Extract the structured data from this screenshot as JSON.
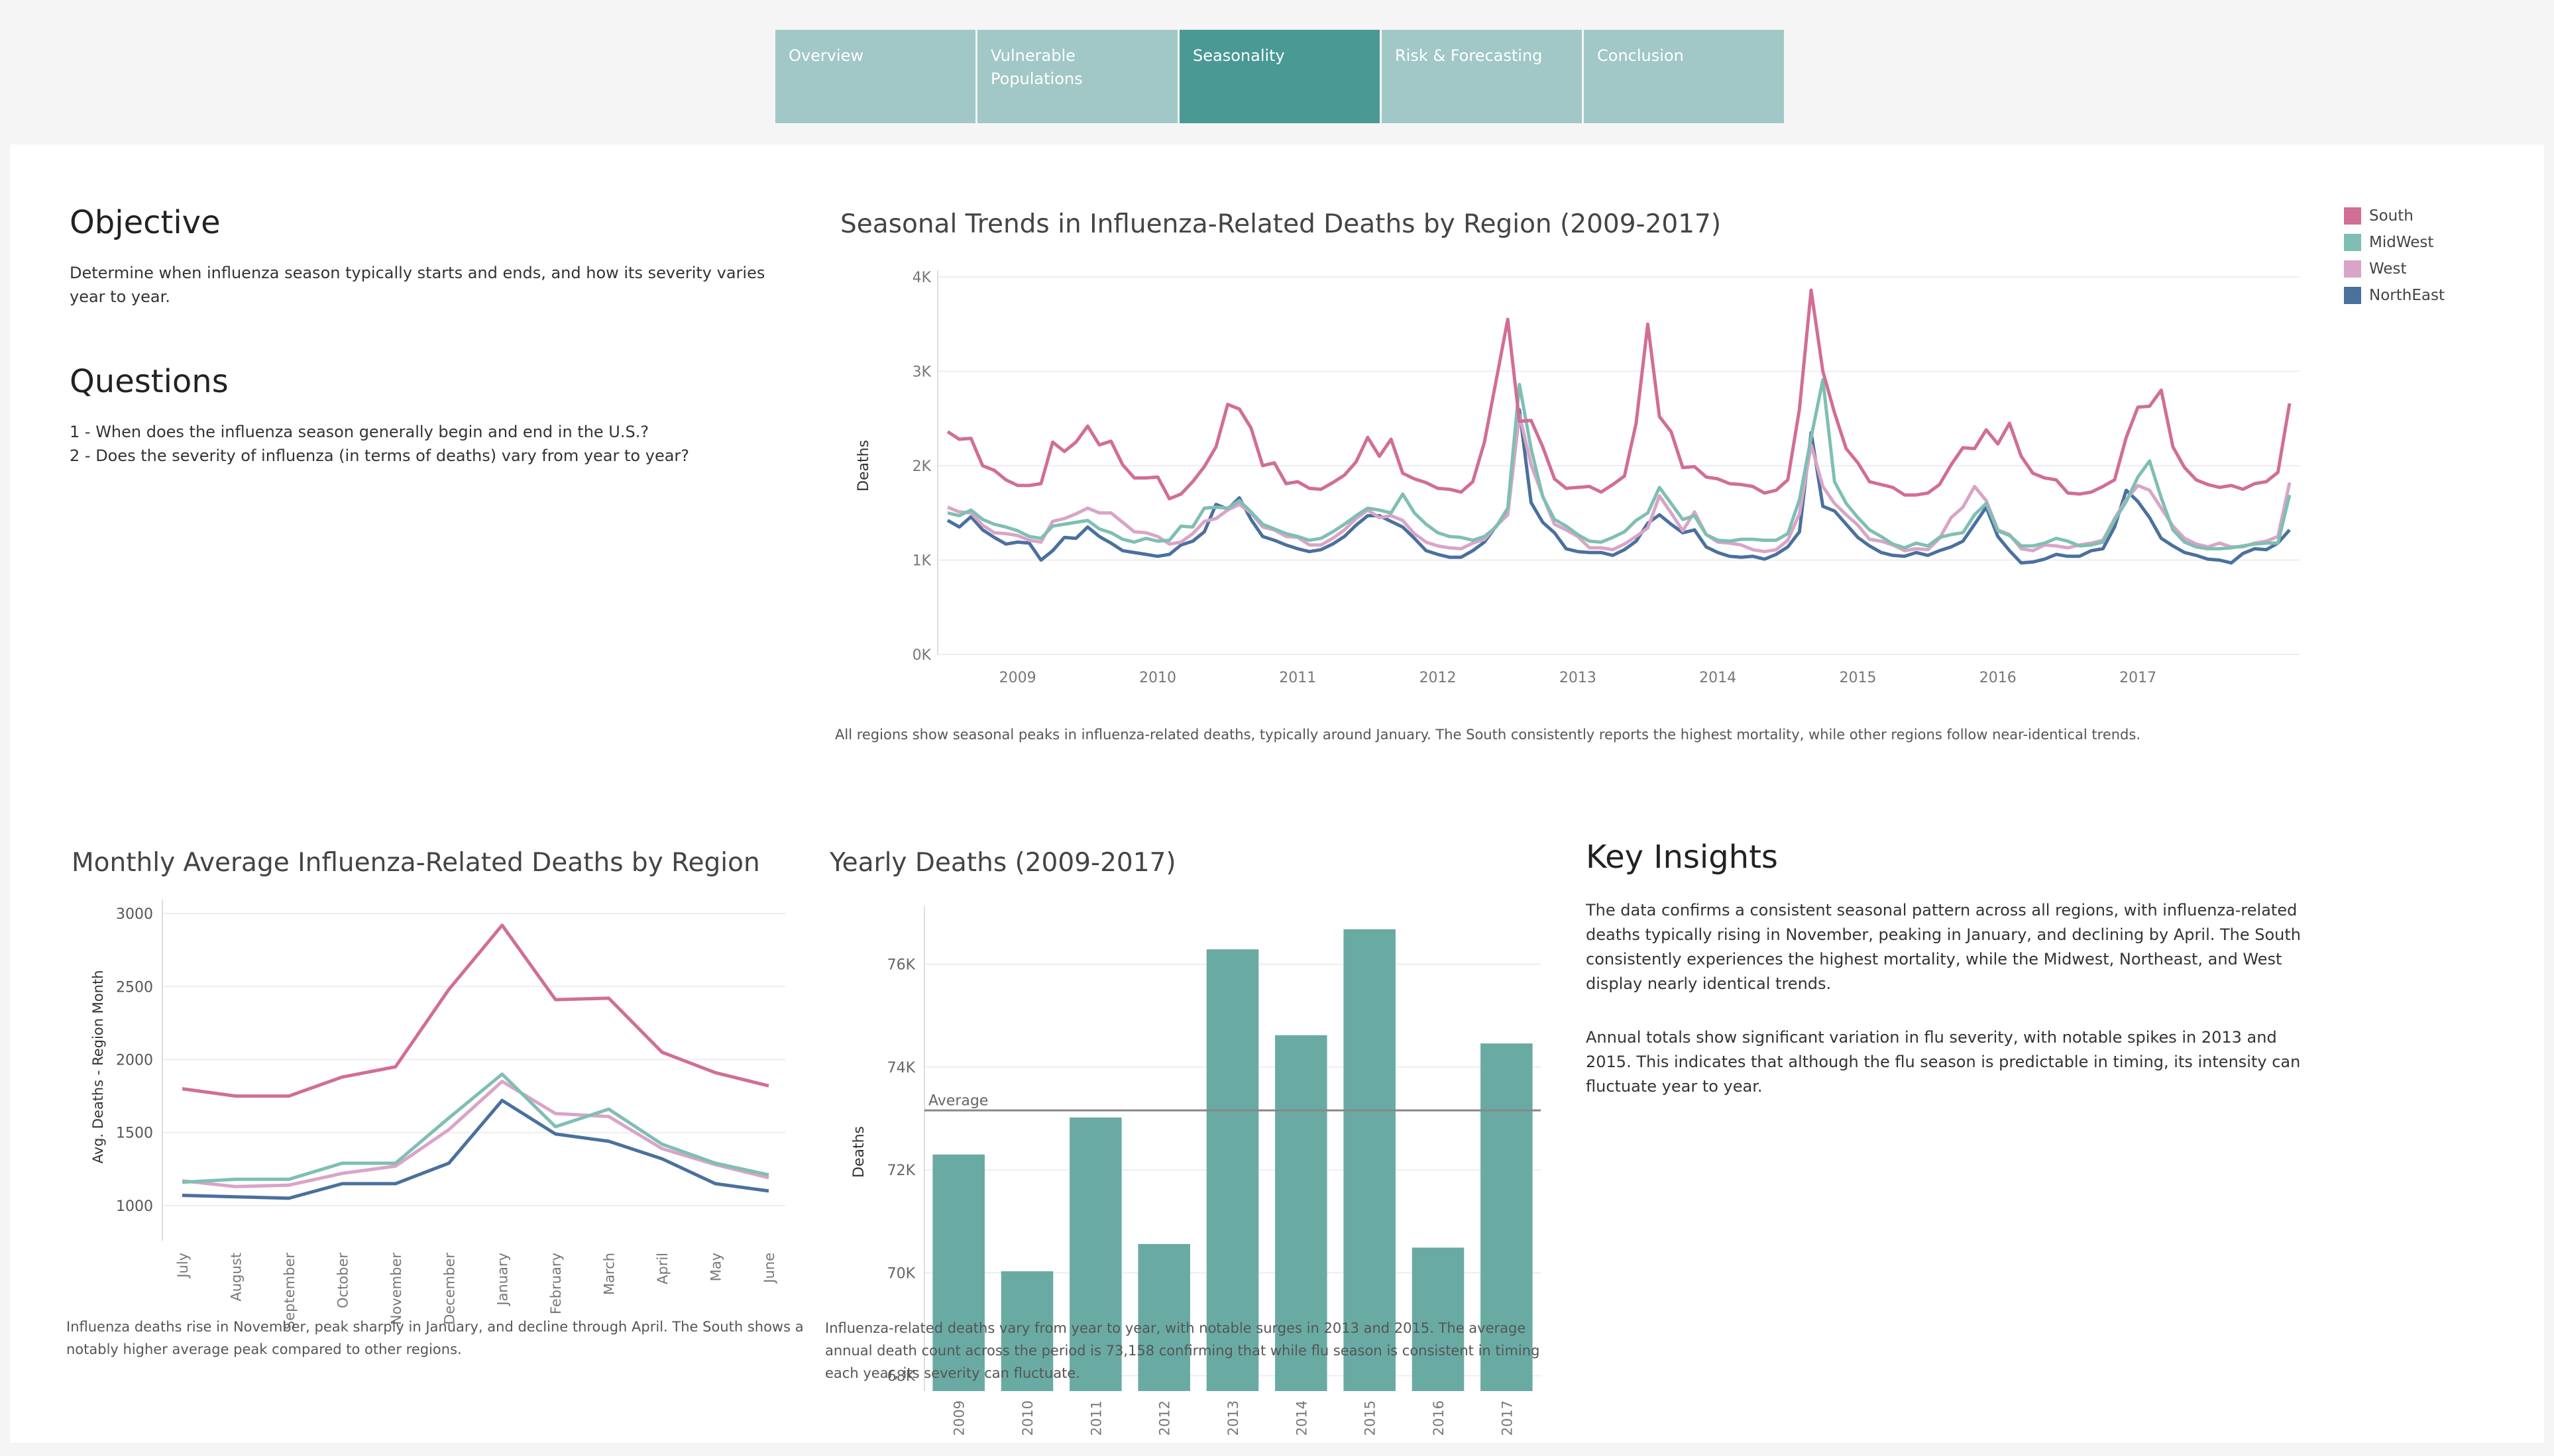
{
  "tabs": [
    {
      "label": "Overview"
    },
    {
      "label": "Vulnerable Populations"
    },
    {
      "label": "Seasonality",
      "active": true
    },
    {
      "label": "Risk & Forecasting"
    },
    {
      "label": "Conclusion"
    }
  ],
  "objective": {
    "title": "Objective",
    "text": "Determine when influenza season typically starts and ends, and how its severity varies year to year."
  },
  "questions": {
    "title": "Questions",
    "q1": "1 - When does the influenza season generally begin and end in the U.S.?",
    "q2": "2 - Does the severity of influenza (in terms of deaths) vary from year to year?"
  },
  "colors": {
    "South": "#d16e95",
    "MidWest": "#7fbfb3",
    "West": "#d9a4c8",
    "NorthEast": "#4a709e",
    "bar": "#69aba3"
  },
  "legend": [
    "South",
    "MidWest",
    "West",
    "NorthEast"
  ],
  "charts": {
    "trend": {
      "title": "Seasonal Trends in Influenza-Related Deaths by Region (2009-2017)",
      "caption": "All regions show seasonal peaks in influenza-related deaths, typically around January. The South consistently reports the highest mortality, while other regions follow near-identical trends.",
      "ylabel": "Deaths"
    },
    "monthly": {
      "title": "Monthly Average Influenza-Related Deaths by Region",
      "caption": "Influenza deaths rise in November, peak sharply in January, and decline through April. The South shows a notably higher average peak compared to other regions.",
      "ylabel": "Avg. Deaths - Region Month"
    },
    "yearly": {
      "title": "Yearly Deaths (2009-2017)",
      "caption": "Influenza-related deaths vary from year to year, with notable surges in 2013 and 2015. The average annual death count across the period is 73,158 confirming that while flu season is consistent in timing each year, its severity can fluctuate.",
      "ylabel": "Deaths",
      "avg_label": "Average"
    }
  },
  "insights": {
    "title": "Key Insights",
    "p1": "The data confirms a consistent seasonal pattern across all regions, with influenza-related deaths typically rising in November, peaking in January, and declining by April. The South consistently experiences the highest mortality, while the Midwest, Northeast, and West display nearly identical trends.",
    "p2": "Annual totals show significant variation in flu severity, with notable spikes in 2013 and 2015. This indicates that although the flu season is predictable in timing, its intensity can fluctuate year to year."
  },
  "chart_data": [
    {
      "type": "line",
      "title": "Seasonal Trends in Influenza-Related Deaths by Region (2009-2017)",
      "ylabel": "Deaths",
      "ylim": [
        0,
        4000
      ],
      "yticks": [
        "0K",
        "1K",
        "2K",
        "3K",
        "4K"
      ],
      "yticks_values": [
        0,
        1000,
        2000,
        3000,
        4000
      ],
      "x_start": "2008-07",
      "xticks": [
        "2009",
        "2010",
        "2011",
        "2012",
        "2013",
        "2014",
        "2015",
        "2016",
        "2017"
      ],
      "series": [
        {
          "name": "South",
          "values": [
            2360,
            2280,
            2290,
            2000,
            1950,
            1850,
            1790,
            1790,
            1810,
            2250,
            2150,
            2250,
            2420,
            2220,
            2260,
            2010,
            1870,
            1870,
            1880,
            1650,
            1700,
            1830,
            1990,
            2200,
            2650,
            2600,
            2400,
            2000,
            2030,
            1810,
            1830,
            1760,
            1750,
            1820,
            1900,
            2040,
            2300,
            2100,
            2280,
            1920,
            1860,
            1820,
            1760,
            1750,
            1720,
            1830,
            2250,
            2900,
            3550,
            2470,
            2480,
            2200,
            1860,
            1760,
            1770,
            1780,
            1720,
            1800,
            1890,
            2450,
            3500,
            2520,
            2360,
            1980,
            1990,
            1880,
            1860,
            1810,
            1800,
            1780,
            1710,
            1740,
            1850,
            2600,
            3860,
            3000,
            2560,
            2180,
            2030,
            1830,
            1800,
            1770,
            1690,
            1690,
            1710,
            1800,
            2010,
            2190,
            2180,
            2380,
            2230,
            2450,
            2100,
            1920,
            1870,
            1850,
            1710,
            1700,
            1720,
            1780,
            1850,
            2300,
            2620,
            2630,
            2800,
            2200,
            1980,
            1850,
            1800,
            1770,
            1790,
            1750,
            1810,
            1830,
            1930,
            2660
          ]
        },
        {
          "name": "MidWest",
          "values": [
            1500,
            1470,
            1530,
            1430,
            1380,
            1350,
            1310,
            1250,
            1230,
            1360,
            1380,
            1400,
            1420,
            1330,
            1290,
            1220,
            1190,
            1230,
            1200,
            1210,
            1360,
            1350,
            1550,
            1560,
            1550,
            1630,
            1510,
            1380,
            1330,
            1280,
            1250,
            1210,
            1230,
            1300,
            1380,
            1470,
            1550,
            1530,
            1500,
            1700,
            1500,
            1380,
            1290,
            1250,
            1240,
            1210,
            1250,
            1350,
            1550,
            2860,
            2180,
            1670,
            1430,
            1360,
            1270,
            1200,
            1190,
            1240,
            1300,
            1420,
            1500,
            1770,
            1600,
            1430,
            1470,
            1270,
            1210,
            1200,
            1220,
            1220,
            1210,
            1210,
            1280,
            1640,
            2300,
            2910,
            1830,
            1600,
            1450,
            1320,
            1250,
            1170,
            1130,
            1180,
            1150,
            1240,
            1270,
            1290,
            1480,
            1600,
            1310,
            1260,
            1150,
            1150,
            1180,
            1230,
            1200,
            1150,
            1160,
            1190,
            1420,
            1620,
            1880,
            2050,
            1660,
            1320,
            1190,
            1140,
            1120,
            1120,
            1130,
            1150,
            1170,
            1180,
            1180,
            1690
          ]
        },
        {
          "name": "West",
          "values": [
            1560,
            1510,
            1500,
            1370,
            1290,
            1280,
            1260,
            1210,
            1190,
            1410,
            1440,
            1490,
            1550,
            1500,
            1500,
            1400,
            1300,
            1290,
            1250,
            1170,
            1190,
            1280,
            1410,
            1440,
            1530,
            1590,
            1500,
            1350,
            1320,
            1250,
            1240,
            1160,
            1160,
            1230,
            1320,
            1440,
            1530,
            1450,
            1470,
            1420,
            1280,
            1190,
            1150,
            1130,
            1120,
            1180,
            1220,
            1360,
            1480,
            2540,
            2010,
            1680,
            1380,
            1320,
            1250,
            1130,
            1130,
            1110,
            1170,
            1250,
            1340,
            1680,
            1500,
            1310,
            1510,
            1270,
            1190,
            1180,
            1160,
            1110,
            1090,
            1110,
            1210,
            1490,
            2220,
            1780,
            1600,
            1480,
            1370,
            1220,
            1200,
            1160,
            1100,
            1120,
            1110,
            1230,
            1450,
            1560,
            1780,
            1630,
            1320,
            1270,
            1120,
            1100,
            1160,
            1150,
            1130,
            1160,
            1180,
            1210,
            1440,
            1640,
            1790,
            1740,
            1550,
            1360,
            1230,
            1170,
            1140,
            1180,
            1140,
            1140,
            1180,
            1200,
            1250,
            1820
          ]
        },
        {
          "name": "NorthEast",
          "values": [
            1420,
            1350,
            1460,
            1320,
            1240,
            1170,
            1190,
            1180,
            1000,
            1100,
            1240,
            1230,
            1350,
            1250,
            1180,
            1100,
            1080,
            1060,
            1040,
            1060,
            1160,
            1200,
            1300,
            1590,
            1540,
            1660,
            1430,
            1250,
            1210,
            1160,
            1120,
            1090,
            1110,
            1170,
            1250,
            1370,
            1470,
            1470,
            1410,
            1350,
            1230,
            1100,
            1060,
            1030,
            1030,
            1100,
            1190,
            1360,
            1490,
            2590,
            1610,
            1400,
            1290,
            1120,
            1090,
            1080,
            1080,
            1050,
            1110,
            1200,
            1390,
            1480,
            1380,
            1290,
            1320,
            1140,
            1080,
            1040,
            1030,
            1040,
            1010,
            1060,
            1140,
            1300,
            2350,
            1570,
            1520,
            1380,
            1240,
            1150,
            1080,
            1050,
            1040,
            1080,
            1050,
            1100,
            1140,
            1200,
            1380,
            1560,
            1250,
            1100,
            970,
            980,
            1010,
            1060,
            1040,
            1040,
            1100,
            1120,
            1350,
            1740,
            1620,
            1450,
            1230,
            1150,
            1080,
            1050,
            1010,
            1000,
            970,
            1070,
            1120,
            1110,
            1180,
            1320
          ]
        }
      ]
    },
    {
      "type": "line",
      "title": "Monthly Average Influenza-Related Deaths by Region",
      "ylabel": "Avg. Deaths - Region Month",
      "ylim": [
        850,
        3050
      ],
      "yticks": [
        "1000",
        "1500",
        "2000",
        "2500",
        "3000"
      ],
      "yticks_values": [
        1000,
        1500,
        2000,
        2500,
        3000
      ],
      "categories": [
        "July",
        "August",
        "September",
        "October",
        "November",
        "December",
        "January",
        "February",
        "March",
        "April",
        "May",
        "June"
      ],
      "series": [
        {
          "name": "South",
          "values": [
            1800,
            1750,
            1750,
            1880,
            1950,
            2480,
            2920,
            2410,
            2420,
            2050,
            1910,
            1820
          ]
        },
        {
          "name": "MidWest",
          "values": [
            1160,
            1180,
            1180,
            1290,
            1290,
            1600,
            1900,
            1540,
            1660,
            1420,
            1290,
            1210
          ]
        },
        {
          "name": "West",
          "values": [
            1170,
            1130,
            1140,
            1220,
            1270,
            1520,
            1850,
            1630,
            1610,
            1390,
            1280,
            1190
          ]
        },
        {
          "name": "NorthEast",
          "values": [
            1070,
            1060,
            1050,
            1150,
            1150,
            1290,
            1720,
            1490,
            1440,
            1320,
            1150,
            1100
          ]
        }
      ]
    },
    {
      "type": "bar",
      "title": "Yearly Deaths (2009-2017)",
      "ylabel": "Deaths",
      "ylim": [
        67700,
        77000
      ],
      "yticks": [
        "68K",
        "70K",
        "72K",
        "74K",
        "76K"
      ],
      "yticks_values": [
        68000,
        70000,
        72000,
        74000,
        76000
      ],
      "categories": [
        "2009",
        "2010",
        "2011",
        "2012",
        "2013",
        "2014",
        "2015",
        "2016",
        "2017"
      ],
      "values": [
        72300,
        70030,
        73020,
        70560,
        76290,
        74620,
        76680,
        70490,
        74460
      ],
      "average": 73158
    }
  ]
}
